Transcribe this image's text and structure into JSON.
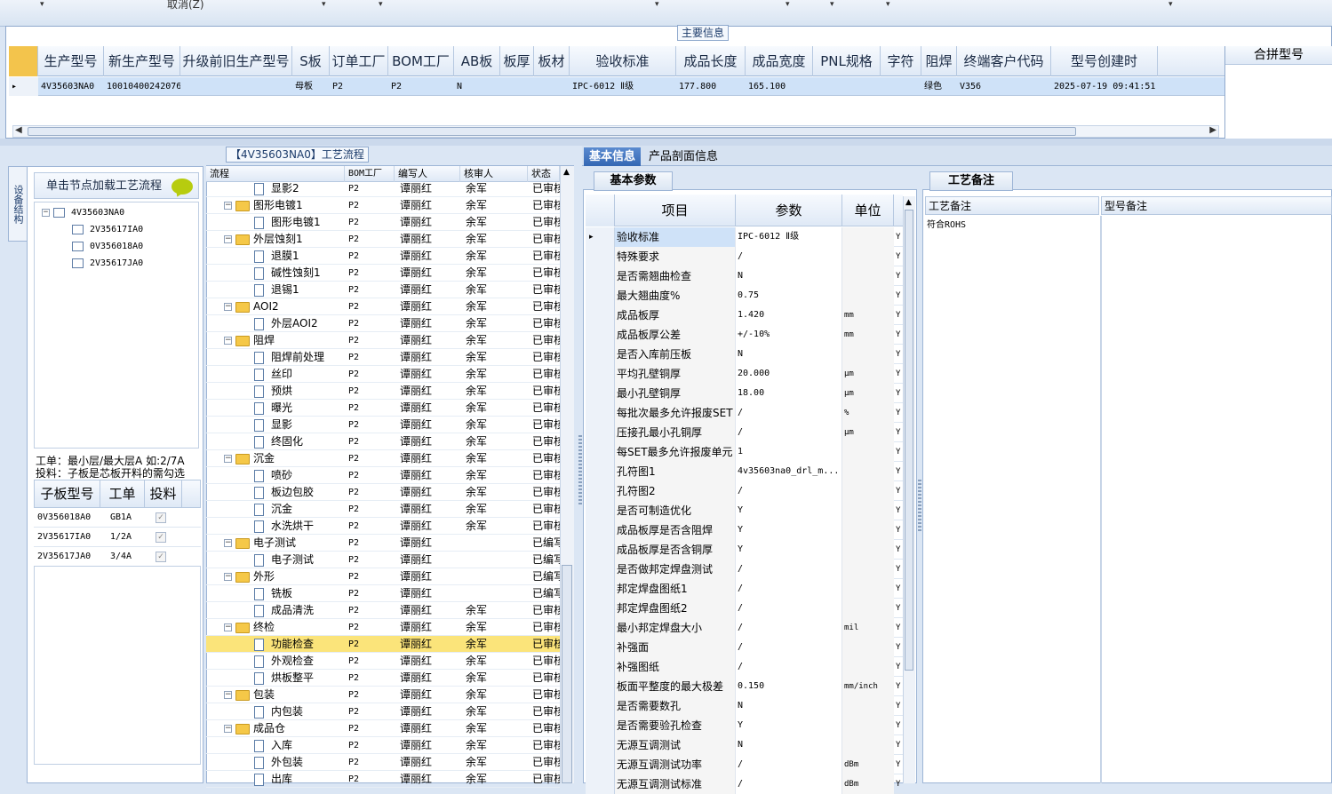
{
  "toolbar": {
    "cancel_label": "取消(Z)"
  },
  "main_info": {
    "section_title": "主要信息",
    "columns": [
      "生产型号",
      "新生产型号",
      "升级前旧生产型号",
      "S板",
      "订单工厂",
      "BOM工厂",
      "AB板",
      "板厚",
      "板材",
      "验收标准",
      "成品长度",
      "成品宽度",
      "PNL规格",
      "字符",
      "阻焊",
      "终端客户代码",
      "型号创建时"
    ],
    "extra_column": "合拼型号",
    "row": {
      "生产型号": "4V35603NA0",
      "新生产型号": "10010400242076",
      "升级前旧生产型号": "",
      "S板": "母板",
      "订单工厂": "P2",
      "BOM工厂": "P2",
      "AB板": "N",
      "板厚": "",
      "板材": "",
      "验收标准": "IPC-6012 Ⅱ级",
      "成品长度": "177.800",
      "成品宽度": "165.100",
      "PNL规格": "",
      "字符": "",
      "阻焊": "绿色",
      "终端客户代码": "V356",
      "型号创建时": "2025-07-19 09:41:51"
    }
  },
  "left": {
    "side_tab": "设备结构",
    "load_button": "单击节点加载工艺流程",
    "tree": {
      "root": "4V35603NA0",
      "children": [
        "2V35617IA0",
        "0V356018A0",
        "2V35617JA0"
      ]
    },
    "note_line1": "工单：最小层/最大层A 如:2/7A",
    "note_line2": "投料：子板是芯板开料的需勾选",
    "sub_columns": [
      "子板型号",
      "工单",
      "投料"
    ],
    "sub_rows": [
      {
        "model": "0V356018A0",
        "order": "GB1A",
        "feed": "✓"
      },
      {
        "model": "2V35617IA0",
        "order": "1/2A",
        "feed": "✓"
      },
      {
        "model": "2V35617JA0",
        "order": "3/4A",
        "feed": "✓"
      }
    ]
  },
  "process": {
    "title": "【4V35603NA0】工艺流程",
    "columns": [
      "流程",
      "BOM工厂",
      "编写人",
      "核审人",
      "状态"
    ],
    "rows": [
      {
        "level": 2,
        "name": "显影2",
        "factory": "P2",
        "writer": "谭丽红",
        "reviewer": "余军",
        "status": "已审核"
      },
      {
        "level": 1,
        "name": "图形电镀1",
        "factory": "P2",
        "writer": "谭丽红",
        "reviewer": "余军",
        "status": "已审核"
      },
      {
        "level": 2,
        "name": "图形电镀1",
        "factory": "P2",
        "writer": "谭丽红",
        "reviewer": "余军",
        "status": "已审核"
      },
      {
        "level": 1,
        "name": "外层蚀刻1",
        "factory": "P2",
        "writer": "谭丽红",
        "reviewer": "余军",
        "status": "已审核"
      },
      {
        "level": 2,
        "name": "退膜1",
        "factory": "P2",
        "writer": "谭丽红",
        "reviewer": "余军",
        "status": "已审核"
      },
      {
        "level": 2,
        "name": "碱性蚀刻1",
        "factory": "P2",
        "writer": "谭丽红",
        "reviewer": "余军",
        "status": "已审核"
      },
      {
        "level": 2,
        "name": "退锡1",
        "factory": "P2",
        "writer": "谭丽红",
        "reviewer": "余军",
        "status": "已审核"
      },
      {
        "level": 1,
        "name": "AOI2",
        "factory": "P2",
        "writer": "谭丽红",
        "reviewer": "余军",
        "status": "已审核"
      },
      {
        "level": 2,
        "name": "外层AOI2",
        "factory": "P2",
        "writer": "谭丽红",
        "reviewer": "余军",
        "status": "已审核"
      },
      {
        "level": 1,
        "name": "阻焊",
        "factory": "P2",
        "writer": "谭丽红",
        "reviewer": "余军",
        "status": "已审核"
      },
      {
        "level": 2,
        "name": "阻焊前处理",
        "factory": "P2",
        "writer": "谭丽红",
        "reviewer": "余军",
        "status": "已审核"
      },
      {
        "level": 2,
        "name": "丝印",
        "factory": "P2",
        "writer": "谭丽红",
        "reviewer": "余军",
        "status": "已审核"
      },
      {
        "level": 2,
        "name": "预烘",
        "factory": "P2",
        "writer": "谭丽红",
        "reviewer": "余军",
        "status": "已审核"
      },
      {
        "level": 2,
        "name": "曝光",
        "factory": "P2",
        "writer": "谭丽红",
        "reviewer": "余军",
        "status": "已审核"
      },
      {
        "level": 2,
        "name": "显影",
        "factory": "P2",
        "writer": "谭丽红",
        "reviewer": "余军",
        "status": "已审核"
      },
      {
        "level": 2,
        "name": "终固化",
        "factory": "P2",
        "writer": "谭丽红",
        "reviewer": "余军",
        "status": "已审核"
      },
      {
        "level": 1,
        "name": "沉金",
        "factory": "P2",
        "writer": "谭丽红",
        "reviewer": "余军",
        "status": "已审核"
      },
      {
        "level": 2,
        "name": "喷砂",
        "factory": "P2",
        "writer": "谭丽红",
        "reviewer": "余军",
        "status": "已审核"
      },
      {
        "level": 2,
        "name": "板边包胶",
        "factory": "P2",
        "writer": "谭丽红",
        "reviewer": "余军",
        "status": "已审核"
      },
      {
        "level": 2,
        "name": "沉金",
        "factory": "P2",
        "writer": "谭丽红",
        "reviewer": "余军",
        "status": "已审核"
      },
      {
        "level": 2,
        "name": "水洗烘干",
        "factory": "P2",
        "writer": "谭丽红",
        "reviewer": "余军",
        "status": "已审核"
      },
      {
        "level": 1,
        "name": "电子测试",
        "factory": "P2",
        "writer": "谭丽红",
        "reviewer": "",
        "status": "已编写"
      },
      {
        "level": 2,
        "name": "电子测试",
        "factory": "P2",
        "writer": "谭丽红",
        "reviewer": "",
        "status": "已编写"
      },
      {
        "level": 1,
        "name": "外形",
        "factory": "P2",
        "writer": "谭丽红",
        "reviewer": "",
        "status": "已编写"
      },
      {
        "level": 2,
        "name": "铣板",
        "factory": "P2",
        "writer": "谭丽红",
        "reviewer": "",
        "status": "已编写"
      },
      {
        "level": 2,
        "name": "成品清洗",
        "factory": "P2",
        "writer": "谭丽红",
        "reviewer": "余军",
        "status": "已审核"
      },
      {
        "level": 1,
        "name": "终检",
        "factory": "P2",
        "writer": "谭丽红",
        "reviewer": "余军",
        "status": "已审核"
      },
      {
        "level": 2,
        "name": "功能检查",
        "factory": "P2",
        "writer": "谭丽红",
        "reviewer": "余军",
        "status": "已审核",
        "selected": true
      },
      {
        "level": 2,
        "name": "外观检查",
        "factory": "P2",
        "writer": "谭丽红",
        "reviewer": "余军",
        "status": "已审核"
      },
      {
        "level": 2,
        "name": "烘板整平",
        "factory": "P2",
        "writer": "谭丽红",
        "reviewer": "余军",
        "status": "已审核"
      },
      {
        "level": 1,
        "name": "包装",
        "factory": "P2",
        "writer": "谭丽红",
        "reviewer": "余军",
        "status": "已审核"
      },
      {
        "level": 2,
        "name": "内包装",
        "factory": "P2",
        "writer": "谭丽红",
        "reviewer": "余军",
        "status": "已审核"
      },
      {
        "level": 1,
        "name": "成品仓",
        "factory": "P2",
        "writer": "谭丽红",
        "reviewer": "余军",
        "status": "已审核"
      },
      {
        "level": 2,
        "name": "入库",
        "factory": "P2",
        "writer": "谭丽红",
        "reviewer": "余军",
        "status": "已审核"
      },
      {
        "level": 2,
        "name": "外包装",
        "factory": "P2",
        "writer": "谭丽红",
        "reviewer": "余军",
        "status": "已审核"
      },
      {
        "level": 2,
        "name": "出库",
        "factory": "P2",
        "writer": "谭丽红",
        "reviewer": "余军",
        "status": "已审核"
      }
    ]
  },
  "tabs": {
    "basic": "基本信息",
    "profile": "产品剖面信息"
  },
  "params": {
    "section_title": "基本参数",
    "columns": [
      "项目",
      "参数",
      "单位"
    ],
    "rows": [
      {
        "item": "验收标准",
        "value": "IPC-6012 Ⅱ级",
        "unit": "",
        "flag": "Y"
      },
      {
        "item": "特殊要求",
        "value": "/",
        "unit": "",
        "flag": "Y"
      },
      {
        "item": "是否需翘曲检查",
        "value": "N",
        "unit": "",
        "flag": "Y"
      },
      {
        "item": "最大翘曲度%",
        "value": "0.75",
        "unit": "",
        "flag": "Y"
      },
      {
        "item": "成品板厚",
        "value": "1.420",
        "unit": "mm",
        "flag": "Y"
      },
      {
        "item": "成品板厚公差",
        "value": "+/-10%",
        "unit": "mm",
        "flag": "Y"
      },
      {
        "item": "是否入库前压板",
        "value": "N",
        "unit": "",
        "flag": "Y"
      },
      {
        "item": "平均孔壁铜厚",
        "value": "20.000",
        "unit": "μm",
        "flag": "Y"
      },
      {
        "item": "最小孔壁铜厚",
        "value": "18.00",
        "unit": "μm",
        "flag": "Y"
      },
      {
        "item": "每批次最多允许报废SET",
        "value": "/",
        "unit": "%",
        "flag": "Y"
      },
      {
        "item": "压接孔最小孔铜厚",
        "value": "/",
        "unit": "μm",
        "flag": "Y"
      },
      {
        "item": "每SET最多允许报废单元",
        "value": "1",
        "unit": "",
        "flag": "Y"
      },
      {
        "item": "孔符图1",
        "value": "4v35603na0_drl_m...",
        "unit": "",
        "flag": "Y"
      },
      {
        "item": "孔符图2",
        "value": "/",
        "unit": "",
        "flag": "Y"
      },
      {
        "item": "是否可制造优化",
        "value": "Y",
        "unit": "",
        "flag": "Y"
      },
      {
        "item": "成品板厚是否含阻焊",
        "value": "Y",
        "unit": "",
        "flag": "Y"
      },
      {
        "item": "成品板厚是否含铜厚",
        "value": "Y",
        "unit": "",
        "flag": "Y"
      },
      {
        "item": "是否做邦定焊盘测试",
        "value": "/",
        "unit": "",
        "flag": "Y"
      },
      {
        "item": "邦定焊盘图纸1",
        "value": "/",
        "unit": "",
        "flag": "Y"
      },
      {
        "item": "邦定焊盘图纸2",
        "value": "/",
        "unit": "",
        "flag": "Y"
      },
      {
        "item": "最小邦定焊盘大小",
        "value": "/",
        "unit": "mil",
        "flag": "Y"
      },
      {
        "item": "补强面",
        "value": "/",
        "unit": "",
        "flag": "Y"
      },
      {
        "item": "补强图纸",
        "value": "/",
        "unit": "",
        "flag": "Y"
      },
      {
        "item": "板面平整度的最大极差",
        "value": "0.150",
        "unit": "mm/inch",
        "flag": "Y"
      },
      {
        "item": "是否需要数孔",
        "value": "N",
        "unit": "",
        "flag": "Y"
      },
      {
        "item": "是否需要验孔检查",
        "value": "Y",
        "unit": "",
        "flag": "Y"
      },
      {
        "item": "无源互调测试",
        "value": "N",
        "unit": "",
        "flag": "Y"
      },
      {
        "item": "无源互调测试功率",
        "value": "/",
        "unit": "dBm",
        "flag": "Y"
      },
      {
        "item": "无源互调测试标准",
        "value": "/",
        "unit": "dBm",
        "flag": "Y"
      }
    ]
  },
  "remarks": {
    "section_title": "工艺备注",
    "col1": "工艺备注",
    "col2": "型号备注",
    "value": "符合ROHS"
  }
}
